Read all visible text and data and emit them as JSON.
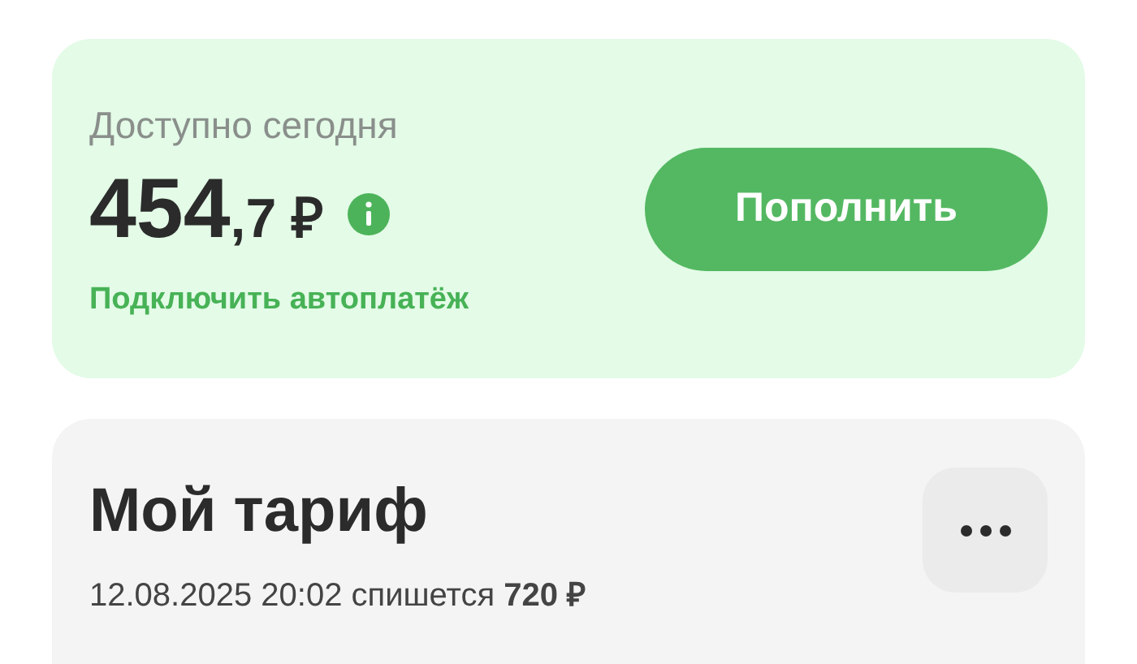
{
  "balance_card": {
    "label": "Доступно сегодня",
    "amount_whole": "454",
    "amount_fraction": ",7 ₽",
    "autopay_link": "Подключить автоплатёж",
    "topup_button": "Пополнить"
  },
  "tariff_card": {
    "title": "Мой тариф",
    "charge_info": "12.08.2025 20:02 спишется **720 ₽**"
  }
}
